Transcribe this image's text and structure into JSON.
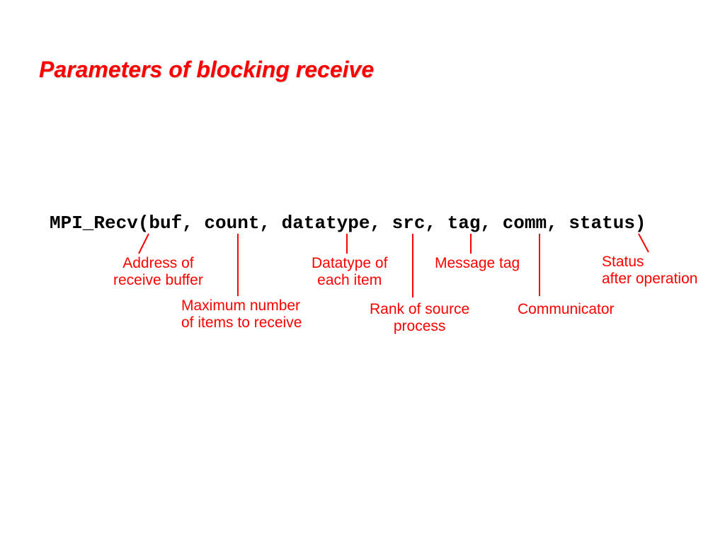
{
  "title": "Parameters of blocking receive",
  "code": "MPI_Recv(buf, count, datatype, src, tag, comm, status)",
  "annotations": {
    "buf": "Address of\nreceive buffer",
    "count": "Maximum number\nof items to receive",
    "datatype": "Datatype of\neach item",
    "src": "Rank of source\nprocess",
    "tag": "Message tag",
    "comm": "Communicator",
    "status": "Status\nafter operation"
  }
}
